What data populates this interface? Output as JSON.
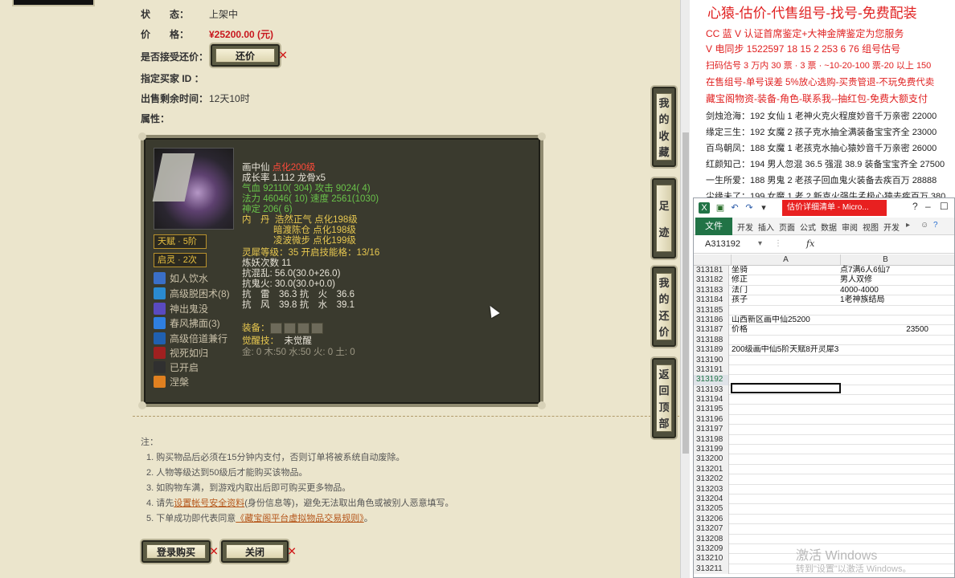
{
  "game": {
    "status_label": "状　　态：",
    "status_value": "上架中",
    "price_label": "价　　格：",
    "price_value": "¥25200.00 (元)",
    "counter_label": "是否接受还价：",
    "counter_button": "还价",
    "buyer_label": "指定买家 ID ：",
    "remaining_label": "出售剩余时间：",
    "remaining_value": "12天10时",
    "attr_label": "属性：",
    "char": {
      "name": "画中仙",
      "level": "点化200级",
      "growth": "成长率 1.112 龙骨x5",
      "hp": "气血 92110( 304)",
      "atk": "攻击 9024( 4)",
      "mp": "法力 46046( 10)",
      "spd": "速度 2561(1030)",
      "mind": "神定 206( 6)",
      "inner_label": "内　丹",
      "inner_1": "浩然正气 点化198级",
      "inner_2": "暗渡陈仓 点化198级",
      "inner_3": "凌波微步 点化199级",
      "spirit": "灵犀等级：35 开启技能格：13/16",
      "refine": "炼妖次数 11",
      "res_1": "抗混乱: 56.0(30.0+26.0)",
      "res_2": "抗鬼火: 30.0(30.0+0.0)",
      "res_3a": "抗　雷　36.3",
      "res_3b": "抗　火　36.6",
      "res_4a": "抗　风　39.8",
      "res_4b": "抗　水　39.1",
      "equip_label": "装备：",
      "awaken_label": "觉醒技：",
      "awaken_value": "未觉醒",
      "elements": "金: 0  木:50  水:50  火: 0  土: 0"
    },
    "talents": [
      "天赋 · 5阶",
      "启灵 · 2次"
    ],
    "skills": [
      "如人饮水",
      "高级脱困术(8)",
      "神出鬼没",
      "春风拂面(3)",
      "高级倍道兼行",
      "视死如归",
      "已开启",
      "涅槃"
    ],
    "skill_colors": [
      "#3a6fc8",
      "#2a8ad0",
      "#5a4ac0",
      "#2f7fe0",
      "#2060b0",
      "#a02020",
      "#303030",
      "#e08020"
    ],
    "notes_title": "注：",
    "notes": [
      "1. 购买物品后必须在15分钟内支付，否则订单将被系统自动废除。",
      "2. 人物等级达到50级后才能购买该物品。",
      "3. 如购物车满，到游戏内取出后即可购买更多物品。"
    ],
    "note_4_pre": "4. 请先",
    "note_4_link": "设置帐号安全资料",
    "note_4_post": "(身份信息等)，避免无法取出角色或被别人恶意填写。",
    "note_5_pre": "5. 下单成功即代表同意",
    "note_5_link": "《藏宝阁平台虚拟物品交易规则》",
    "note_5_post": "。",
    "login_buy_button": "登录购买",
    "close_button": "关闭",
    "side_tabs": [
      "我的收藏",
      "足迹",
      "我的还价",
      "返回顶部"
    ]
  },
  "doc": {
    "title": "心猿-估价-代售组号-找号-免费配装",
    "lines": [
      "CC 蓝 V 认证首席鉴定+大神金牌鉴定为您服务",
      "V 电同步 1522597 18 15 2 253 6 76 组号估号",
      "扫码估号 3 万内 30 票 · 3 票 · ~10-20-100 票-20 以上 150",
      "在售组号-单号误差 5%放心选购-买贵管退-不玩免费代卖",
      "藏宝阁物资-装备-角色-联系我--抽红包-免费大额支付"
    ],
    "entries": [
      "剑烛沧海：192 女仙 1 老神火克火程度妙音千万亲密 22000",
      "缘定三生：192 女魔 2 孩子克水抽全满装备宝宝齐全 23000",
      "百鸟朝凤：188 女魔 1 老孩克水抽心猿妙音千万亲密 26000",
      "红颜知己：194 男人忽混 36.5 强混 38.9 装备宝宝齐全 27500",
      "一生所爱：188 男鬼 2 老孩子回血鬼火装备去疾百万 28888",
      "尘缘未了：199 女魔 1 老 2 新克火强牛孟极心猿去疾百万 380"
    ]
  },
  "excel": {
    "title": "估价详细清单 - Micro...",
    "ribbon_tabs": [
      "文件",
      "开发",
      "插入",
      "页面",
      "公式",
      "数据",
      "审阅",
      "视图",
      "开发"
    ],
    "name_box": "A313192",
    "fx": "fx",
    "columns": [
      "A",
      "B"
    ],
    "rows": [
      {
        "n": "313181",
        "a": "坐骑",
        "b": "点7满6人6仙7"
      },
      {
        "n": "313182",
        "a": "修正",
        "b": "男人双修"
      },
      {
        "n": "313183",
        "a": "法门",
        "b": "4000-4000"
      },
      {
        "n": "313184",
        "a": "孩子",
        "b": "1老神族结局"
      },
      {
        "n": "313185",
        "a": "",
        "b": ""
      },
      {
        "n": "313186",
        "a": "山西新区画中仙25200",
        "b": ""
      },
      {
        "n": "313187",
        "a": "价格",
        "b": "23500"
      },
      {
        "n": "313188",
        "a": "",
        "b": ""
      },
      {
        "n": "313189",
        "a": "200级画中仙5阶天赋8开灵犀35",
        "b": ""
      },
      {
        "n": "313190",
        "a": "",
        "b": ""
      },
      {
        "n": "313191",
        "a": "",
        "b": ""
      },
      {
        "n": "313192",
        "a": "",
        "b": ""
      },
      {
        "n": "313193",
        "a": "",
        "b": ""
      },
      {
        "n": "313194",
        "a": "",
        "b": ""
      },
      {
        "n": "313195",
        "a": "",
        "b": ""
      },
      {
        "n": "313196",
        "a": "",
        "b": ""
      },
      {
        "n": "313197",
        "a": "",
        "b": ""
      },
      {
        "n": "313198",
        "a": "",
        "b": ""
      },
      {
        "n": "313199",
        "a": "",
        "b": ""
      },
      {
        "n": "313200",
        "a": "",
        "b": ""
      },
      {
        "n": "313201",
        "a": "",
        "b": ""
      },
      {
        "n": "313202",
        "a": "",
        "b": ""
      },
      {
        "n": "313203",
        "a": "",
        "b": ""
      },
      {
        "n": "313204",
        "a": "",
        "b": ""
      },
      {
        "n": "313205",
        "a": "",
        "b": ""
      },
      {
        "n": "313206",
        "a": "",
        "b": ""
      },
      {
        "n": "313207",
        "a": "",
        "b": ""
      },
      {
        "n": "313208",
        "a": "",
        "b": ""
      },
      {
        "n": "313209",
        "a": "",
        "b": ""
      },
      {
        "n": "313210",
        "a": "",
        "b": ""
      },
      {
        "n": "313211",
        "a": "",
        "b": ""
      }
    ]
  },
  "watermark": {
    "line1": "激活 Windows",
    "line2": "转到\"设置\"以激活 Windows。"
  }
}
